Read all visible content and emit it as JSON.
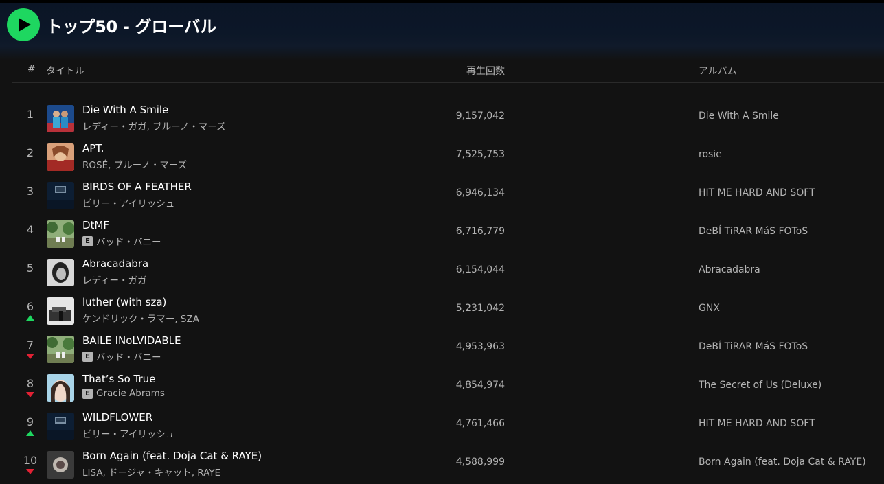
{
  "header": {
    "title": "トップ50 - グローバル"
  },
  "columns": {
    "rank": "#",
    "title": "タイトル",
    "plays": "再生回数",
    "album": "アルバム"
  },
  "colors": {
    "accent": "#1ed760",
    "up": "#1ed760",
    "down": "#e22134"
  },
  "tracks": [
    {
      "rank": "1",
      "title": "Die With A Smile",
      "artists": "レディー・ガガ, ブルーノ・マーズ",
      "explicit": false,
      "plays": "9,157,042",
      "album": "Die With A Smile",
      "trend": "none",
      "cover": "cover-die-with-a-smile"
    },
    {
      "rank": "2",
      "title": "APT.",
      "artists": "ROSÉ, ブルーノ・マーズ",
      "explicit": false,
      "plays": "7,525,753",
      "album": "rosie",
      "trend": "none",
      "cover": "cover-rosie"
    },
    {
      "rank": "3",
      "title": "BIRDS OF A FEATHER",
      "artists": "ビリー・アイリッシュ",
      "explicit": false,
      "plays": "6,946,134",
      "album": "HIT ME HARD AND SOFT",
      "trend": "none",
      "cover": "cover-hit-me-hard"
    },
    {
      "rank": "4",
      "title": "DtMF",
      "artists": "バッド・バニー",
      "explicit": true,
      "plays": "6,716,779",
      "album": "DeBÍ TiRAR MáS FOToS",
      "trend": "none",
      "cover": "cover-debi-tirar"
    },
    {
      "rank": "5",
      "title": "Abracadabra",
      "artists": "レディー・ガガ",
      "explicit": false,
      "plays": "6,154,044",
      "album": "Abracadabra",
      "trend": "none",
      "cover": "cover-abracadabra"
    },
    {
      "rank": "6",
      "title": "luther (with sza)",
      "artists": "ケンドリック・ラマー, SZA",
      "explicit": false,
      "plays": "5,231,042",
      "album": "GNX",
      "trend": "up",
      "cover": "cover-gnx"
    },
    {
      "rank": "7",
      "title": "BAILE INoLVIDABLE",
      "artists": "バッド・バニー",
      "explicit": true,
      "plays": "4,953,963",
      "album": "DeBÍ TiRAR MáS FOToS",
      "trend": "down",
      "cover": "cover-debi-tirar"
    },
    {
      "rank": "8",
      "title": "That’s So True",
      "artists": "Gracie Abrams",
      "explicit": true,
      "plays": "4,854,974",
      "album": "The Secret of Us (Deluxe)",
      "trend": "down",
      "cover": "cover-secret-of-us"
    },
    {
      "rank": "9",
      "title": "WILDFLOWER",
      "artists": "ビリー・アイリッシュ",
      "explicit": false,
      "plays": "4,761,466",
      "album": "HIT ME HARD AND SOFT",
      "trend": "up",
      "cover": "cover-hit-me-hard"
    },
    {
      "rank": "10",
      "title": "Born Again (feat. Doja Cat & RAYE)",
      "artists": "LISA, ドージャ・キャット, RAYE",
      "explicit": false,
      "plays": "4,588,999",
      "album": "Born Again (feat. Doja Cat & RAYE)",
      "trend": "down",
      "cover": "cover-born-again"
    }
  ]
}
